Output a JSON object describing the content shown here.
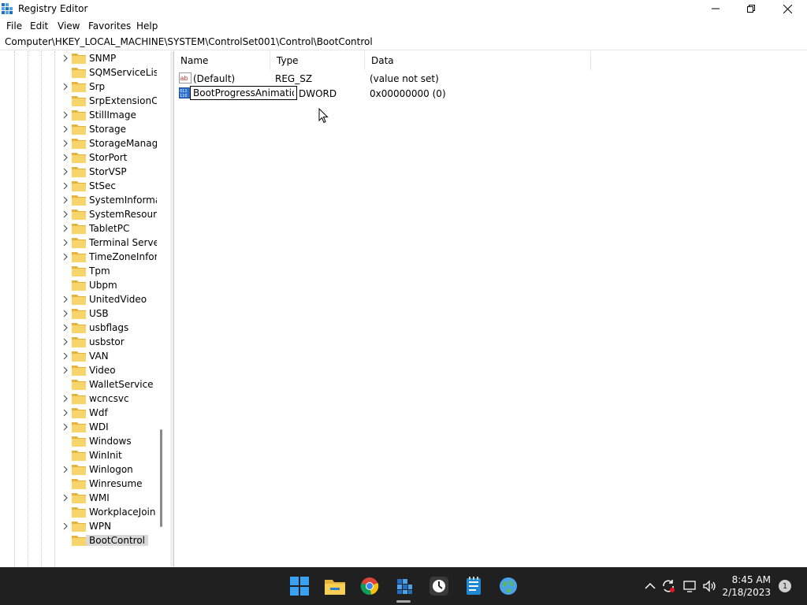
{
  "window": {
    "title": "Registry Editor"
  },
  "menu": [
    "File",
    "Edit",
    "View",
    "Favorites",
    "Help"
  ],
  "address": "Computer\\HKEY_LOCAL_MACHINE\\SYSTEM\\ControlSet001\\Control\\BootControl",
  "tree": [
    {
      "label": "SNMP",
      "expandable": true
    },
    {
      "label": "SQMServiceList",
      "expandable": false
    },
    {
      "label": "Srp",
      "expandable": true
    },
    {
      "label": "SrpExtensionConfig",
      "expandable": false
    },
    {
      "label": "StillImage",
      "expandable": true
    },
    {
      "label": "Storage",
      "expandable": true
    },
    {
      "label": "StorageManagement",
      "expandable": true
    },
    {
      "label": "StorPort",
      "expandable": true
    },
    {
      "label": "StorVSP",
      "expandable": true
    },
    {
      "label": "StSec",
      "expandable": true
    },
    {
      "label": "SystemInformation",
      "expandable": true
    },
    {
      "label": "SystemResources",
      "expandable": true
    },
    {
      "label": "TabletPC",
      "expandable": true
    },
    {
      "label": "Terminal Server",
      "expandable": true
    },
    {
      "label": "TimeZoneInformation",
      "expandable": true
    },
    {
      "label": "Tpm",
      "expandable": false
    },
    {
      "label": "Ubpm",
      "expandable": false
    },
    {
      "label": "UnitedVideo",
      "expandable": true
    },
    {
      "label": "USB",
      "expandable": true
    },
    {
      "label": "usbflags",
      "expandable": true
    },
    {
      "label": "usbstor",
      "expandable": true
    },
    {
      "label": "VAN",
      "expandable": true
    },
    {
      "label": "Video",
      "expandable": true
    },
    {
      "label": "WalletService",
      "expandable": false
    },
    {
      "label": "wcncsvc",
      "expandable": true
    },
    {
      "label": "Wdf",
      "expandable": true
    },
    {
      "label": "WDI",
      "expandable": true
    },
    {
      "label": "Windows",
      "expandable": false
    },
    {
      "label": "WinInit",
      "expandable": false
    },
    {
      "label": "Winlogon",
      "expandable": true
    },
    {
      "label": "Winresume",
      "expandable": false
    },
    {
      "label": "WMI",
      "expandable": true
    },
    {
      "label": "WorkplaceJoin",
      "expandable": false
    },
    {
      "label": "WPN",
      "expandable": true
    },
    {
      "label": "BootControl",
      "expandable": false,
      "selected": true
    }
  ],
  "columns": {
    "name": "Name",
    "type": "Type",
    "data": "Data"
  },
  "values": [
    {
      "name": "(Default)",
      "type": "REG_SZ",
      "data": "(value not set)",
      "icon": "string-value-icon"
    },
    {
      "name": "BootProgressAnimation",
      "type": "REG_DWORD",
      "type_visible": "DWORD",
      "data": "0x00000000 (0)",
      "icon": "binary-value-icon",
      "renaming": true
    }
  ],
  "clock": {
    "time": "8:45 AM",
    "date": "2/18/2023"
  },
  "notifications": "1"
}
